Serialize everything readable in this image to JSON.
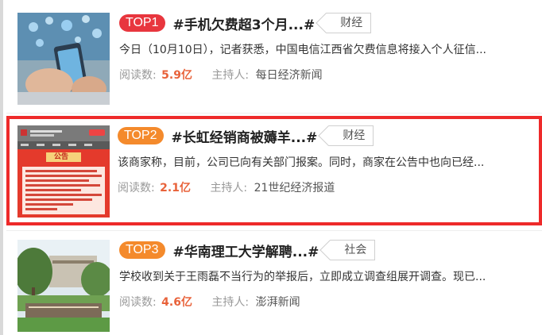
{
  "items": [
    {
      "rank": "TOP1",
      "title": "#手机欠费超3个月...#",
      "tag": "财经",
      "summary": "今日（10月10日），记者获悉，中国电信江西省欠费信息将接入个人征信...",
      "reads_label": "阅读数:",
      "reads": "5.9亿",
      "host_label": "主持人:",
      "host": "每日经济新闻"
    },
    {
      "rank": "TOP2",
      "title": "#长虹经销商被薅羊...#",
      "tag": "财经",
      "summary": "该商家称，目前，公司已向有关部门报案。同时，商家在公告中也向已经...",
      "reads_label": "阅读数:",
      "reads": "2.1亿",
      "host_label": "主持人:",
      "host": "21世纪经济报道",
      "image_text": "公告"
    },
    {
      "rank": "TOP3",
      "title": "#华南理工大学解聘...#",
      "tag": "社会",
      "summary": "学校收到关于王雨磊不当行为的举报后，立即成立调查组展开调查。现已...",
      "reads_label": "阅读数:",
      "reads": "4.6亿",
      "host_label": "主持人:",
      "host": "澎湃新闻"
    }
  ]
}
